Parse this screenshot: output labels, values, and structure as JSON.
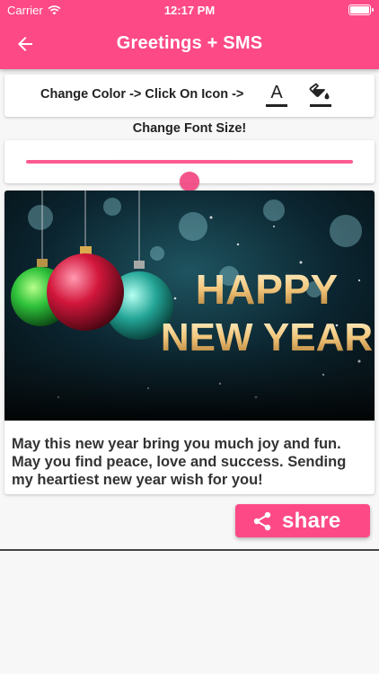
{
  "status": {
    "carrier": "Carrier",
    "time": "12:17 PM",
    "battery_level": 1.0
  },
  "header": {
    "title": "Greetings + SMS",
    "back_icon": "arrow-back-icon"
  },
  "controls": {
    "color_label": "Change Color -> Click On Icon ->",
    "font_color_glyph": "A",
    "font_color_icon": "text-color-icon",
    "fill_icon": "fill-bucket-icon",
    "font_size_label": "Change Font Size!",
    "font_size_value": 0.5
  },
  "card": {
    "image_text_line1": "HAPPY",
    "image_text_line2": "NEW YEAR",
    "message": "May this new year bring you much joy and fun. May you find peace, love and success. Sending my heartiest new year wish for you!"
  },
  "share": {
    "label": "share",
    "icon": "share-icon"
  },
  "colors": {
    "accent": "#fd4a86",
    "text": "#333333",
    "background": "#f7f7f7"
  }
}
